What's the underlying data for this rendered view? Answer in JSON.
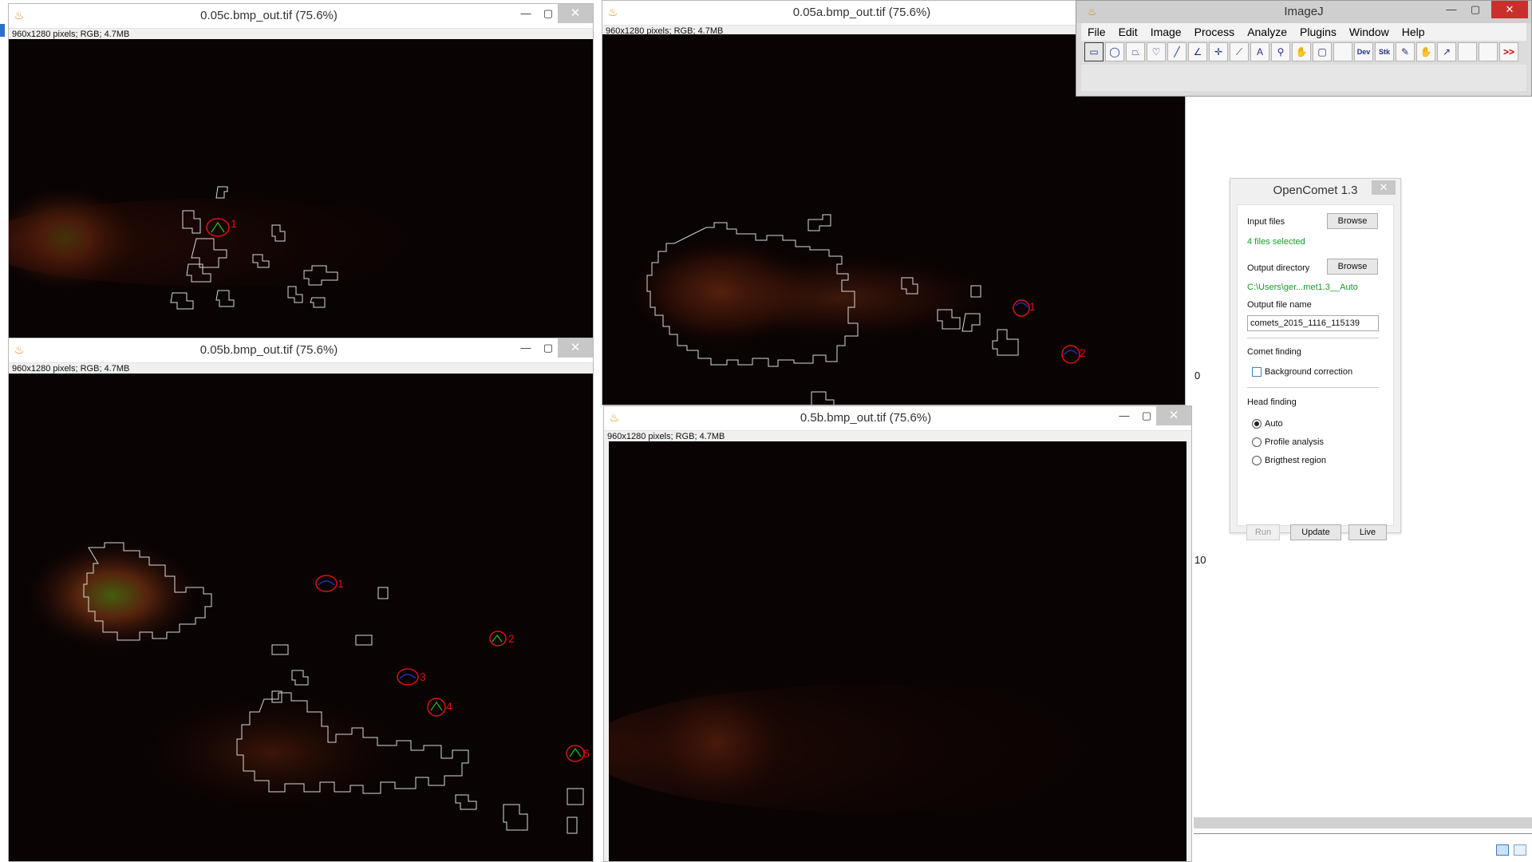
{
  "image_windows": [
    {
      "id": "c",
      "title": "0.05c.bmp_out.tif (75.6%)",
      "info": "960x1280 pixels; RGB; 4.7MB",
      "labels": [
        "1"
      ]
    },
    {
      "id": "a",
      "title": "0.05a.bmp_out.tif (75.6%)",
      "info": "960x1280 pixels; RGB; 4.7MB",
      "labels": [
        "1",
        "2"
      ]
    },
    {
      "id": "b",
      "title": "0.05b.bmp_out.tif (75.6%)",
      "info": "960x1280 pixels; RGB; 4.7MB",
      "labels": [
        "1",
        "2",
        "3",
        "4",
        "5"
      ]
    },
    {
      "id": "d",
      "title": "0.5b.bmp_out.tif (75.6%)",
      "info": "960x1280 pixels; RGB; 4.7MB",
      "labels": []
    }
  ],
  "window_controls": {
    "minimize": "—",
    "maximize": "▢",
    "close": "✕"
  },
  "imagej": {
    "title": "ImageJ",
    "menus": [
      "File",
      "Edit",
      "Image",
      "Process",
      "Analyze",
      "Plugins",
      "Window",
      "Help"
    ],
    "tools": [
      {
        "icon": "rectangle-tool-icon",
        "glyph": "▭",
        "selected": true
      },
      {
        "icon": "oval-tool-icon",
        "glyph": "◯"
      },
      {
        "icon": "polygon-tool-icon",
        "glyph": "⏢"
      },
      {
        "icon": "freehand-tool-icon",
        "glyph": "♡"
      },
      {
        "icon": "line-tool-icon",
        "glyph": "╱"
      },
      {
        "icon": "angle-tool-icon",
        "glyph": "∠"
      },
      {
        "icon": "point-tool-icon",
        "glyph": "✛"
      },
      {
        "icon": "wand-tool-icon",
        "glyph": "⟋"
      },
      {
        "icon": "text-tool-icon",
        "glyph": "A"
      },
      {
        "icon": "magnifier-tool-icon",
        "glyph": "⚲"
      },
      {
        "icon": "hand-tool-icon",
        "glyph": "✋"
      },
      {
        "icon": "color-picker-tool-icon",
        "glyph": "▢"
      },
      {
        "icon": "blank-tool-icon",
        "glyph": ""
      },
      {
        "icon": "dev-tool-icon",
        "glyph": "Dev",
        "text": true
      },
      {
        "icon": "stk-tool-icon",
        "glyph": "Stk",
        "text": true
      },
      {
        "icon": "pencil-tool-icon",
        "glyph": "✎"
      },
      {
        "icon": "brush-tool-icon",
        "glyph": "✋"
      },
      {
        "icon": "pipette-tool-icon",
        "glyph": "↗"
      },
      {
        "icon": "blank-tool-icon",
        "glyph": ""
      },
      {
        "icon": "blank-tool-icon",
        "glyph": ""
      },
      {
        "icon": "more-tools-icon",
        "glyph": ">>",
        "red": true
      }
    ]
  },
  "opencomet": {
    "title": "OpenComet 1.3",
    "input_files_label": "Input files",
    "browse_label": "Browse",
    "files_selected": "4 files selected",
    "output_directory_label": "Output directory",
    "output_directory_value": "C:\\Users\\ger...met1.3__Auto",
    "output_file_name_label": "Output file name",
    "output_file_name_value": "comets_2015_1116_115139",
    "comet_finding_label": "Comet finding",
    "background_correction_label": "Background correction",
    "background_correction_checked": false,
    "head_finding_label": "Head finding",
    "head_options": [
      {
        "label": "Auto",
        "selected": true
      },
      {
        "label": "Profile analysis",
        "selected": false
      },
      {
        "label": "Brigthest region",
        "selected": false
      }
    ],
    "run_label": "Run",
    "update_label": "Update",
    "live_label": "Live"
  },
  "side_numbers": [
    "0",
    "10"
  ],
  "colors": {
    "canvas": "#090303",
    "outline": "#e6e6e6",
    "head": "#e01010",
    "profile": "#2030c0",
    "guide": "#20c020",
    "tail_glow": "#7a2a10"
  }
}
